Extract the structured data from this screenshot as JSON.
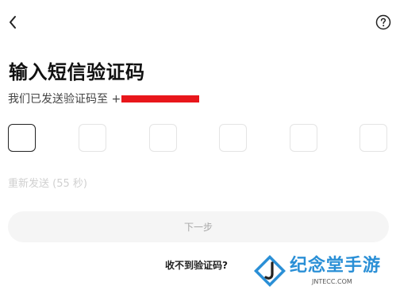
{
  "header": {
    "back_icon": "chevron-left-icon",
    "help_icon": "question-circle-icon"
  },
  "title": "输入短信验证码",
  "subtitle": {
    "prefix": "我们已发送验证码至 +"
  },
  "code_boxes": [
    "",
    "",
    "",
    "",
    "",
    ""
  ],
  "resend_label": "重新发送 (55 秒)",
  "next_button": {
    "label": "下一步"
  },
  "no_code_link": "收不到验证码?",
  "watermark": {
    "name": "纪念堂手游",
    "domain": "JNTECC.COM"
  },
  "colors": {
    "redaction": "#e8161b",
    "watermark": "#2a8fd6"
  }
}
